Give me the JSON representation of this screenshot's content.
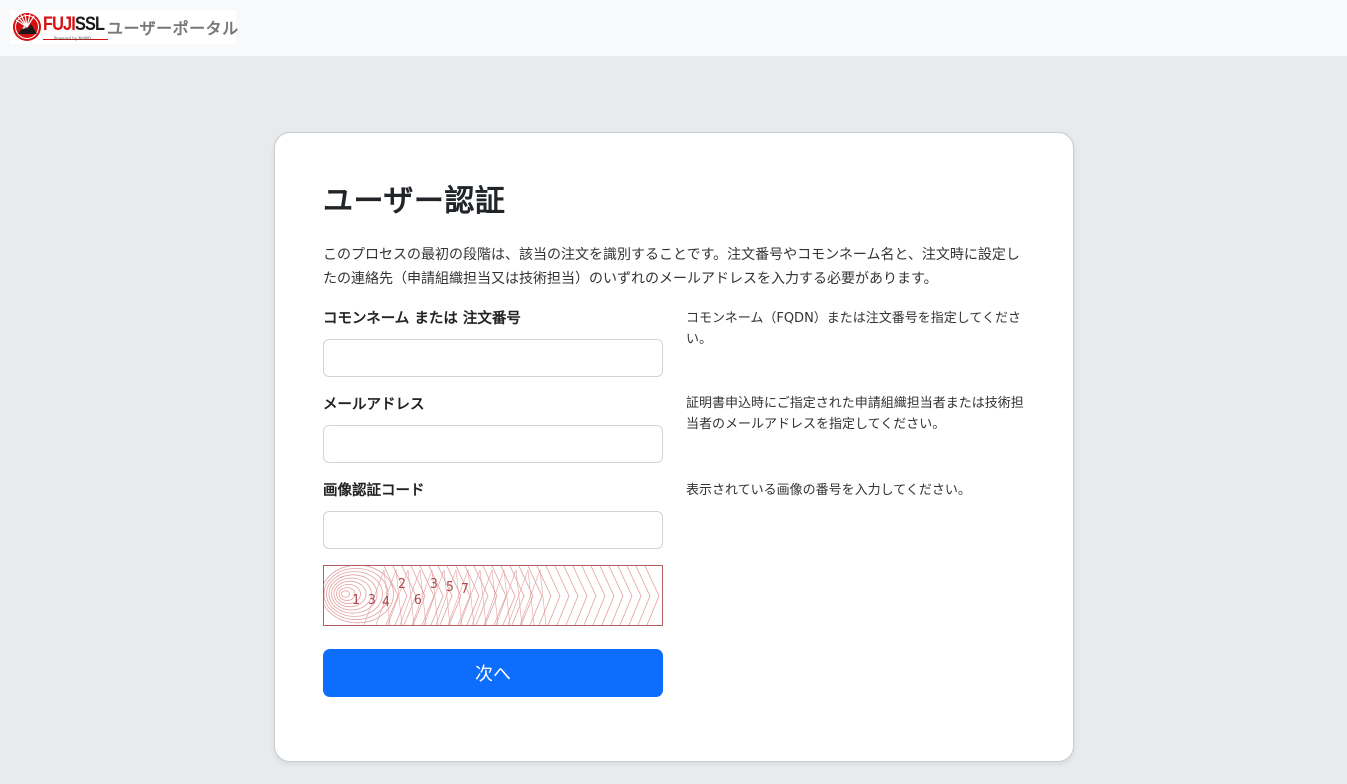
{
  "header": {
    "brand_fuji": "FUJI",
    "brand_ssl": "SSL",
    "powered_by": "Powered by NUMO",
    "portal_title": "ユーザーポータル"
  },
  "form": {
    "title": "ユーザー認証",
    "intro": "このプロセスの最初の段階は、該当の注文を識別することです。注文番号やコモンネーム名と、注文時に設定したの連絡先（申請組織担当又は技術担当）のいずれのメールアドレスを入力する必要があります。",
    "fields": [
      {
        "label": "コモンネーム または 注文番号",
        "help": "コモンネーム（FQDN）または注文番号を指定してください。",
        "value": "",
        "placeholder": ""
      },
      {
        "label": "メールアドレス",
        "help": "証明書申込時にご指定された申請組織担当者または技術担当者のメールアドレスを指定してください。",
        "value": "",
        "placeholder": ""
      },
      {
        "label": "画像認証コード",
        "help": "表示されている画像の番号を入力してください。",
        "value": "",
        "placeholder": ""
      }
    ],
    "captcha_digits": [
      "1",
      "3",
      "4",
      "2",
      "6",
      "3",
      "5",
      "7"
    ],
    "submit_label": "次へ"
  },
  "colors": {
    "accent": "#0d6efd",
    "brand_red": "#d41010",
    "captcha_line": "#e3a0a0"
  }
}
